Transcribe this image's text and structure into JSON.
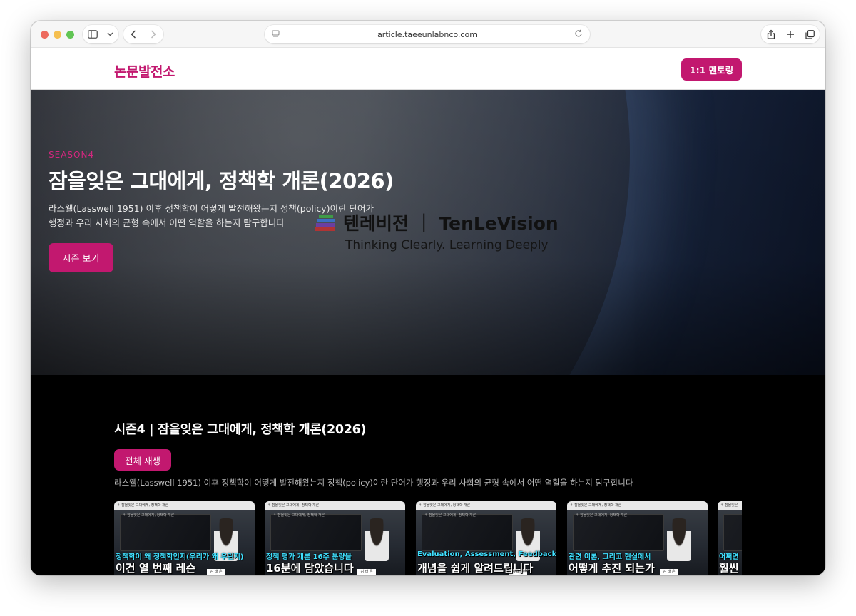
{
  "browser": {
    "url": "article.taeeunlabnco.com",
    "icons": [
      "sidebar-icon",
      "chevron-down-icon",
      "back-icon",
      "forward-icon",
      "page-icon",
      "reload-icon",
      "share-icon",
      "plus-icon",
      "tabs-icon"
    ]
  },
  "header": {
    "logo": "논문발전소",
    "mentor_button": "1:1 멘토링"
  },
  "hero": {
    "season_label": "SEASON4",
    "title": "잠을잊은 그대에게, 정책학 개론(2026)",
    "description": "라스웰(Lasswell 1951) 이후 정책학이 어떻게 발전해왔는지 정책(policy)이란 단어가 행정과 우리 사회의 균형 속에서 어떤 역할을 하는지 탐구합니다",
    "button": "시즌 보기",
    "watermark": {
      "title": "텐레비전 ｜ TenLeVision",
      "subtitle": "Thinking Clearly. Learning Deeply"
    }
  },
  "section": {
    "title": "시즌4 | 잠을잊은 그대에게, 정책학 개론(2026)",
    "play_all": "전체 재생",
    "description": "라스웰(Lasswell 1951) 이후 정책학이 어떻게 발전해왔는지 정책(policy)이란 단어가 행정과 우리 사회의 균형 속에서 어떤 역할을 하는지 탐구합니다",
    "videos": [
      {
        "caption_top": "정책학이 왜 정책학인지(우리가 왜 우린지)",
        "caption_bottom": "이건 열 번째 레슨"
      },
      {
        "caption_top": "정책 평가 개론 16주 분량을",
        "caption_bottom": "16분에 담았습니다"
      },
      {
        "caption_top": "Evaluation, Assessment, Feedback...?",
        "caption_bottom": "개념을 쉽게 알려드립니다"
      },
      {
        "caption_top": "관련 이론, 그리고 현실에서",
        "caption_bottom": "어떻게 추진 되는가"
      },
      {
        "caption_top": "어쩌면",
        "caption_bottom": "훨씬"
      }
    ]
  },
  "colors": {
    "accent": "#c2186f",
    "caption_cyan": "#3fe0ff"
  }
}
